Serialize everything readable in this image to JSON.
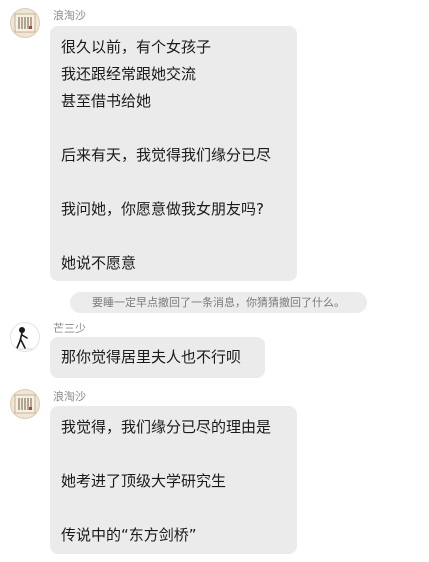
{
  "messages": [
    {
      "sender": "浪淘沙",
      "avatar": "scroll-avatar",
      "lines": [
        "很久以前，有个女孩子",
        "我还跟经常跟她交流",
        "甚至借书给她",
        "",
        "后来有天，我觉得我们缘分已尽",
        "",
        "我问她，你愿意做我女朋友吗?",
        "",
        "她说不愿意"
      ]
    },
    {
      "system_notice": "要睡一定早点撤回了一条消息，你猜猜撤回了什么。"
    },
    {
      "sender": "芒三少",
      "avatar": "figure-avatar",
      "lines": [
        "那你觉得居里夫人也不行呗"
      ]
    },
    {
      "sender": "浪淘沙",
      "avatar": "scroll-avatar",
      "lines": [
        "我觉得，我们缘分已尽的理由是",
        "",
        "她考进了顶级大学研究生",
        "",
        "传说中的“东方剑桥”"
      ]
    }
  ],
  "colors": {
    "bubble": "#ebebeb",
    "notice_bg": "#ececec",
    "sender_name": "#8a8a8a",
    "text": "#1a1a1a"
  }
}
